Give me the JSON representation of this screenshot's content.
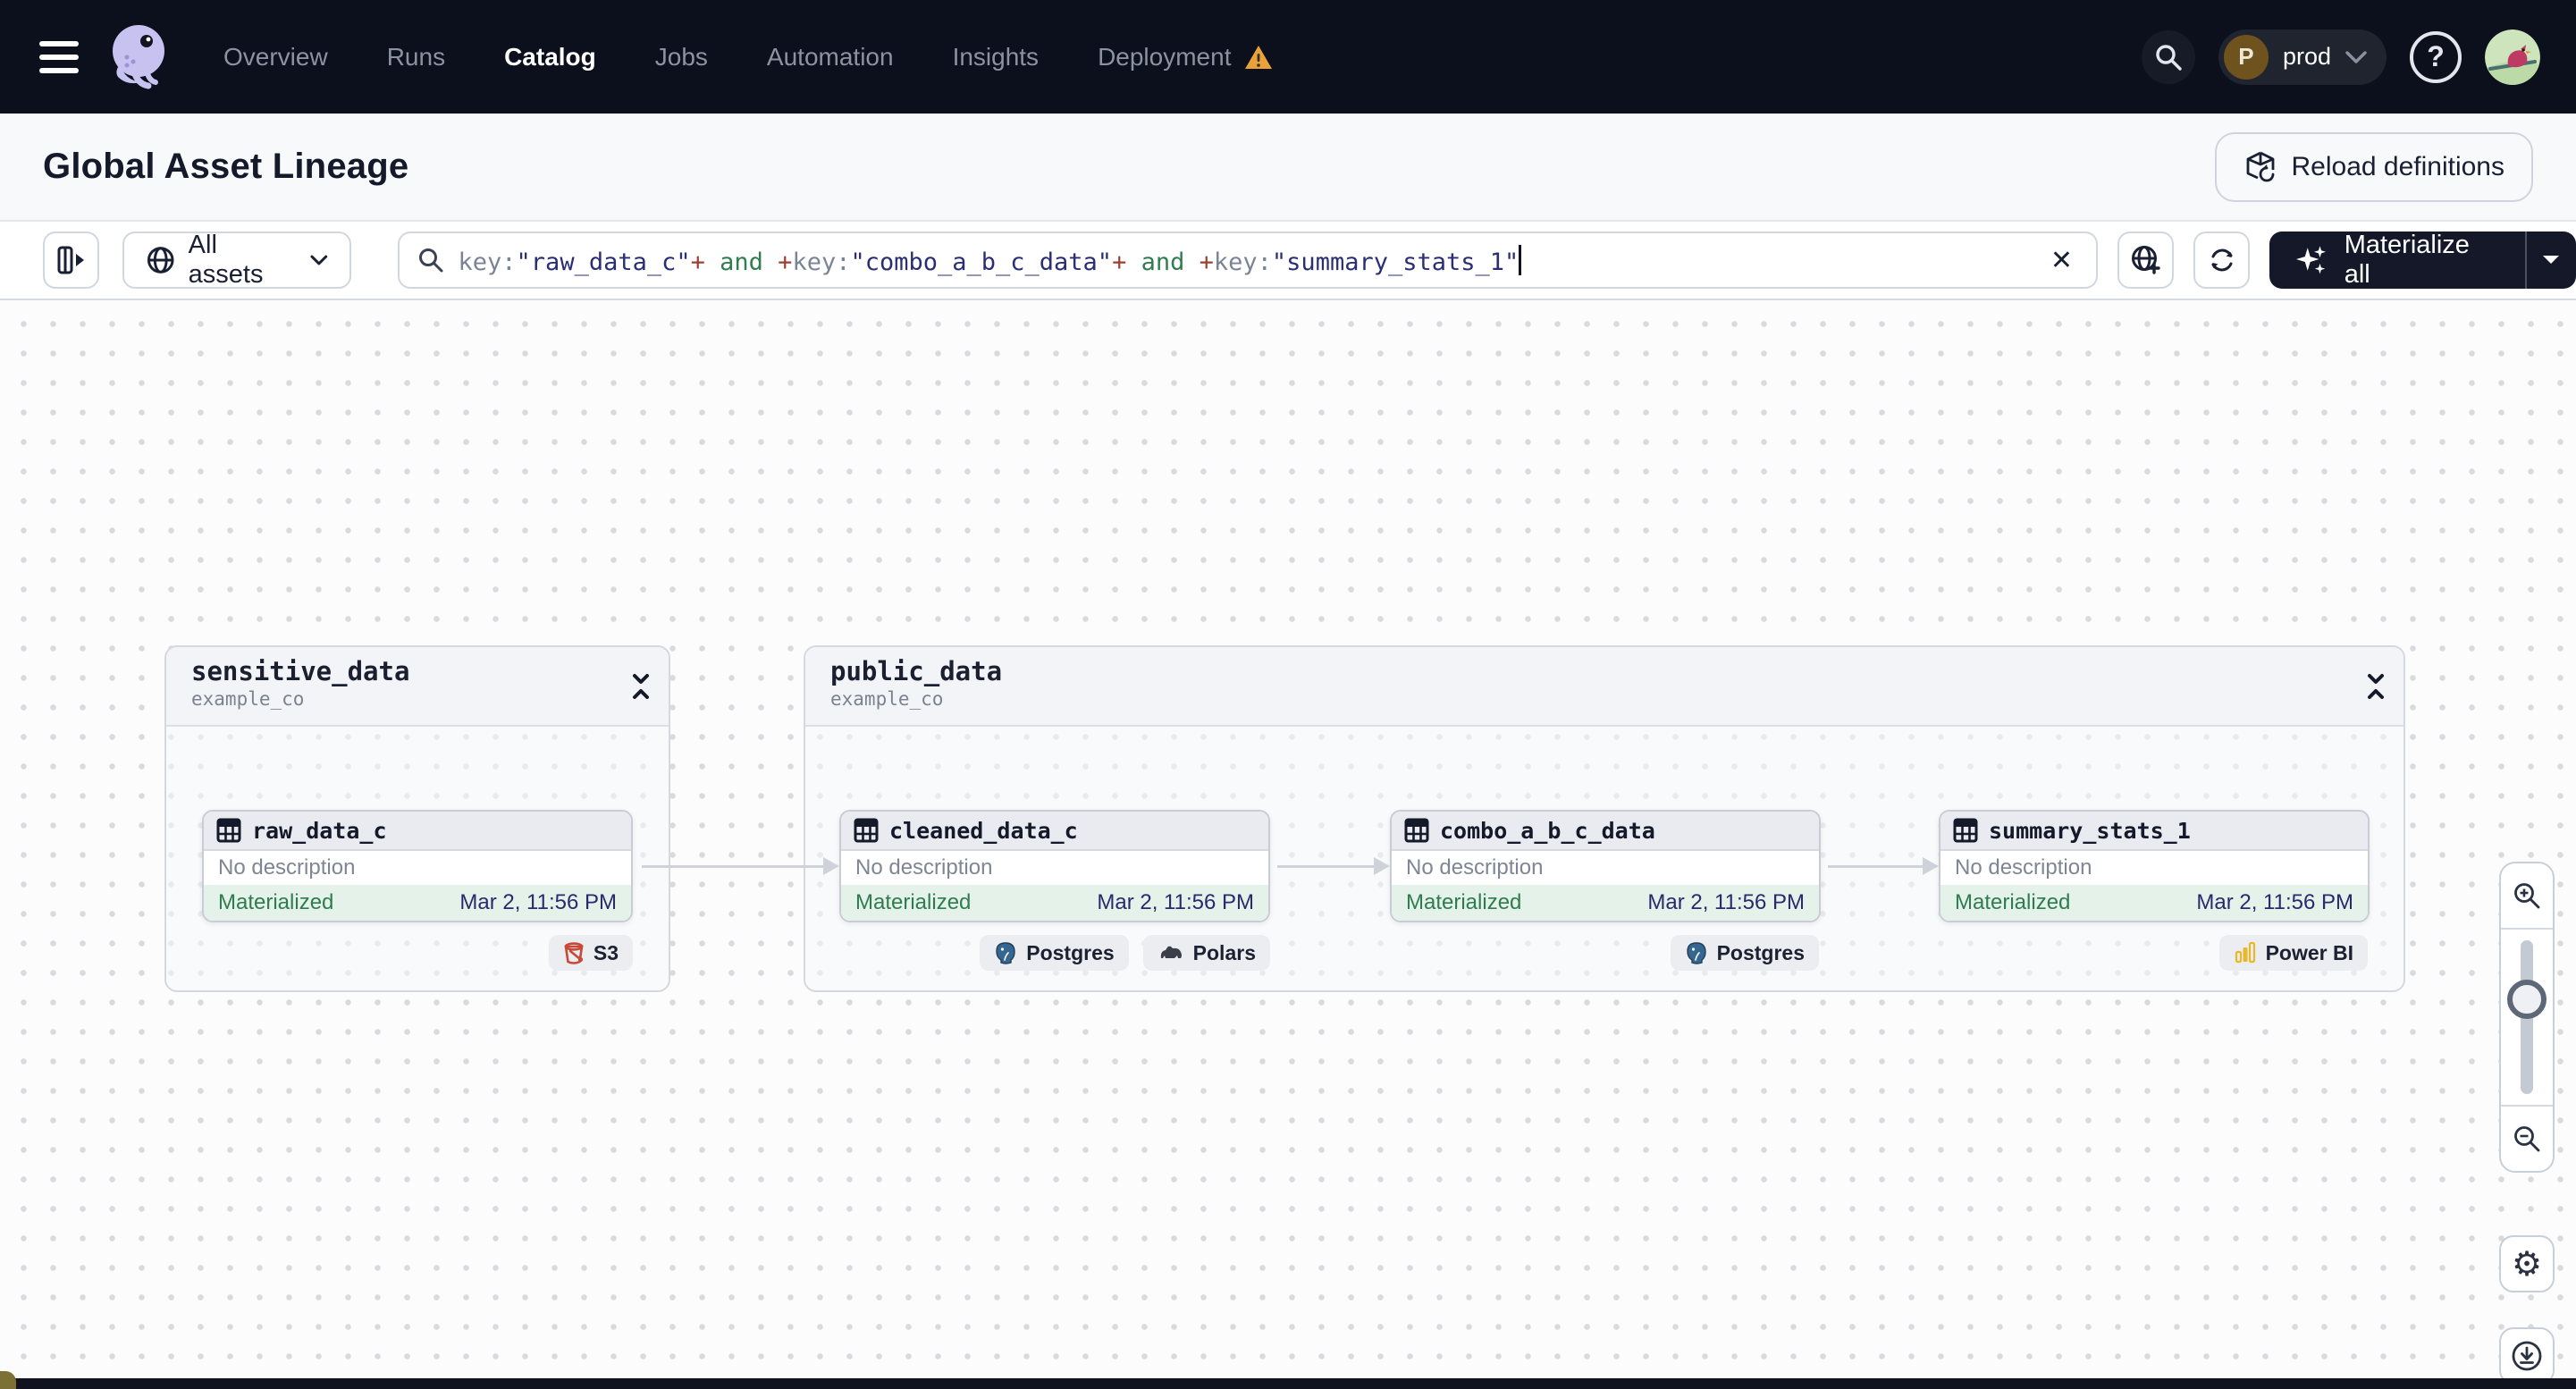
{
  "navbar": {
    "items": [
      {
        "label": "Overview",
        "active": false
      },
      {
        "label": "Runs",
        "active": false
      },
      {
        "label": "Catalog",
        "active": true
      },
      {
        "label": "Jobs",
        "active": false
      },
      {
        "label": "Automation",
        "active": false
      },
      {
        "label": "Insights",
        "active": false
      },
      {
        "label": "Deployment",
        "active": false,
        "warning": true
      }
    ],
    "deployment_warning_color": "#e9a23b",
    "prod": {
      "initial": "P",
      "label": "prod"
    }
  },
  "header": {
    "title": "Global Asset Lineage",
    "reload_label": "Reload definitions"
  },
  "toolbar": {
    "scope_label": "All assets",
    "materialize_label": "Materialize all",
    "query": {
      "full": "key:\"raw_data_c\"+ and +key:\"combo_a_b_c_data\"+ and +key:\"summary_stats_1\"",
      "segments": [
        {
          "text": "key:",
          "type": "key"
        },
        {
          "text": "\"raw_data_c\"",
          "type": "val"
        },
        {
          "text": "+",
          "type": "op"
        },
        {
          "text": " and ",
          "type": "and"
        },
        {
          "text": "+",
          "type": "op"
        },
        {
          "text": "key:",
          "type": "key"
        },
        {
          "text": "\"combo_a_b_c_data\"",
          "type": "val"
        },
        {
          "text": "+",
          "type": "op"
        },
        {
          "text": " and ",
          "type": "and"
        },
        {
          "text": "+",
          "type": "op"
        },
        {
          "text": "key:",
          "type": "key"
        },
        {
          "text": "\"summary_stats_1\"",
          "type": "val"
        }
      ],
      "colors": {
        "key": "#7b8494",
        "value": "#2a2e74",
        "operator": "#9c3f30",
        "and": "#2f7d51"
      }
    }
  },
  "graph": {
    "groups": [
      {
        "name": "sensitive_data",
        "repo": "example_co",
        "nodes": [
          {
            "name": "raw_data_c",
            "description": "No description",
            "status": "Materialized",
            "timestamp": "Mar 2, 11:56 PM",
            "tags": [
              {
                "label": "S3",
                "icon": "s3-bucket-icon"
              }
            ]
          }
        ]
      },
      {
        "name": "public_data",
        "repo": "example_co",
        "nodes": [
          {
            "name": "cleaned_data_c",
            "description": "No description",
            "status": "Materialized",
            "timestamp": "Mar 2, 11:56 PM",
            "tags": [
              {
                "label": "Postgres",
                "icon": "postgres-icon"
              },
              {
                "label": "Polars",
                "icon": "polars-icon"
              }
            ]
          },
          {
            "name": "combo_a_b_c_data",
            "description": "No description",
            "status": "Materialized",
            "timestamp": "Mar 2, 11:56 PM",
            "tags": [
              {
                "label": "Postgres",
                "icon": "postgres-icon"
              }
            ]
          },
          {
            "name": "summary_stats_1",
            "description": "No description",
            "status": "Materialized",
            "timestamp": "Mar 2, 11:56 PM",
            "tags": [
              {
                "label": "Power BI",
                "icon": "power-bi-icon"
              }
            ]
          }
        ]
      }
    ],
    "status_colors": {
      "materialized_text": "#2f7c50",
      "materialized_bg": "#e4f2e9",
      "timestamp": "#262b6e"
    }
  },
  "icons": {
    "help": "?",
    "close": "✕",
    "gear": "⚙"
  }
}
